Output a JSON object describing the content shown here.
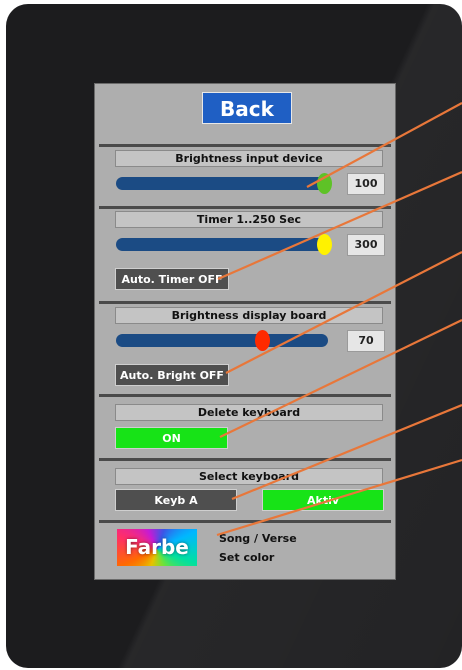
{
  "panel": {
    "back_label": "Back",
    "brightness_input": {
      "label": "Brightness input device",
      "value": "100",
      "level": 1.0,
      "knob_color": "#5ec227"
    },
    "timer": {
      "label": "Timer 1..250 Sec",
      "value": "300",
      "level": 1.0,
      "knob_color": "#fff200",
      "auto_label": "Auto. Timer OFF"
    },
    "brightness_display": {
      "label": "Brightness display board",
      "value": "70",
      "level": 0.7,
      "knob_color": "#ff2a00",
      "auto_label": "Auto. Bright OFF"
    },
    "delete_keyboard": {
      "label": "Delete keyboard",
      "button_label": "ON"
    },
    "select_keyboard": {
      "label": "Select keyboard",
      "keyboard_label": "Keyb A",
      "status_label": "Aktiv"
    },
    "song_color": {
      "farbe_label": "Farbe",
      "line1": "Song / Verse",
      "line2": "Set color"
    }
  },
  "colors": {
    "accent_blue": "#1f5fc4",
    "active_green": "#17e317",
    "annotation_orange": "#e8773a",
    "slider_track": "#1b4b84"
  }
}
